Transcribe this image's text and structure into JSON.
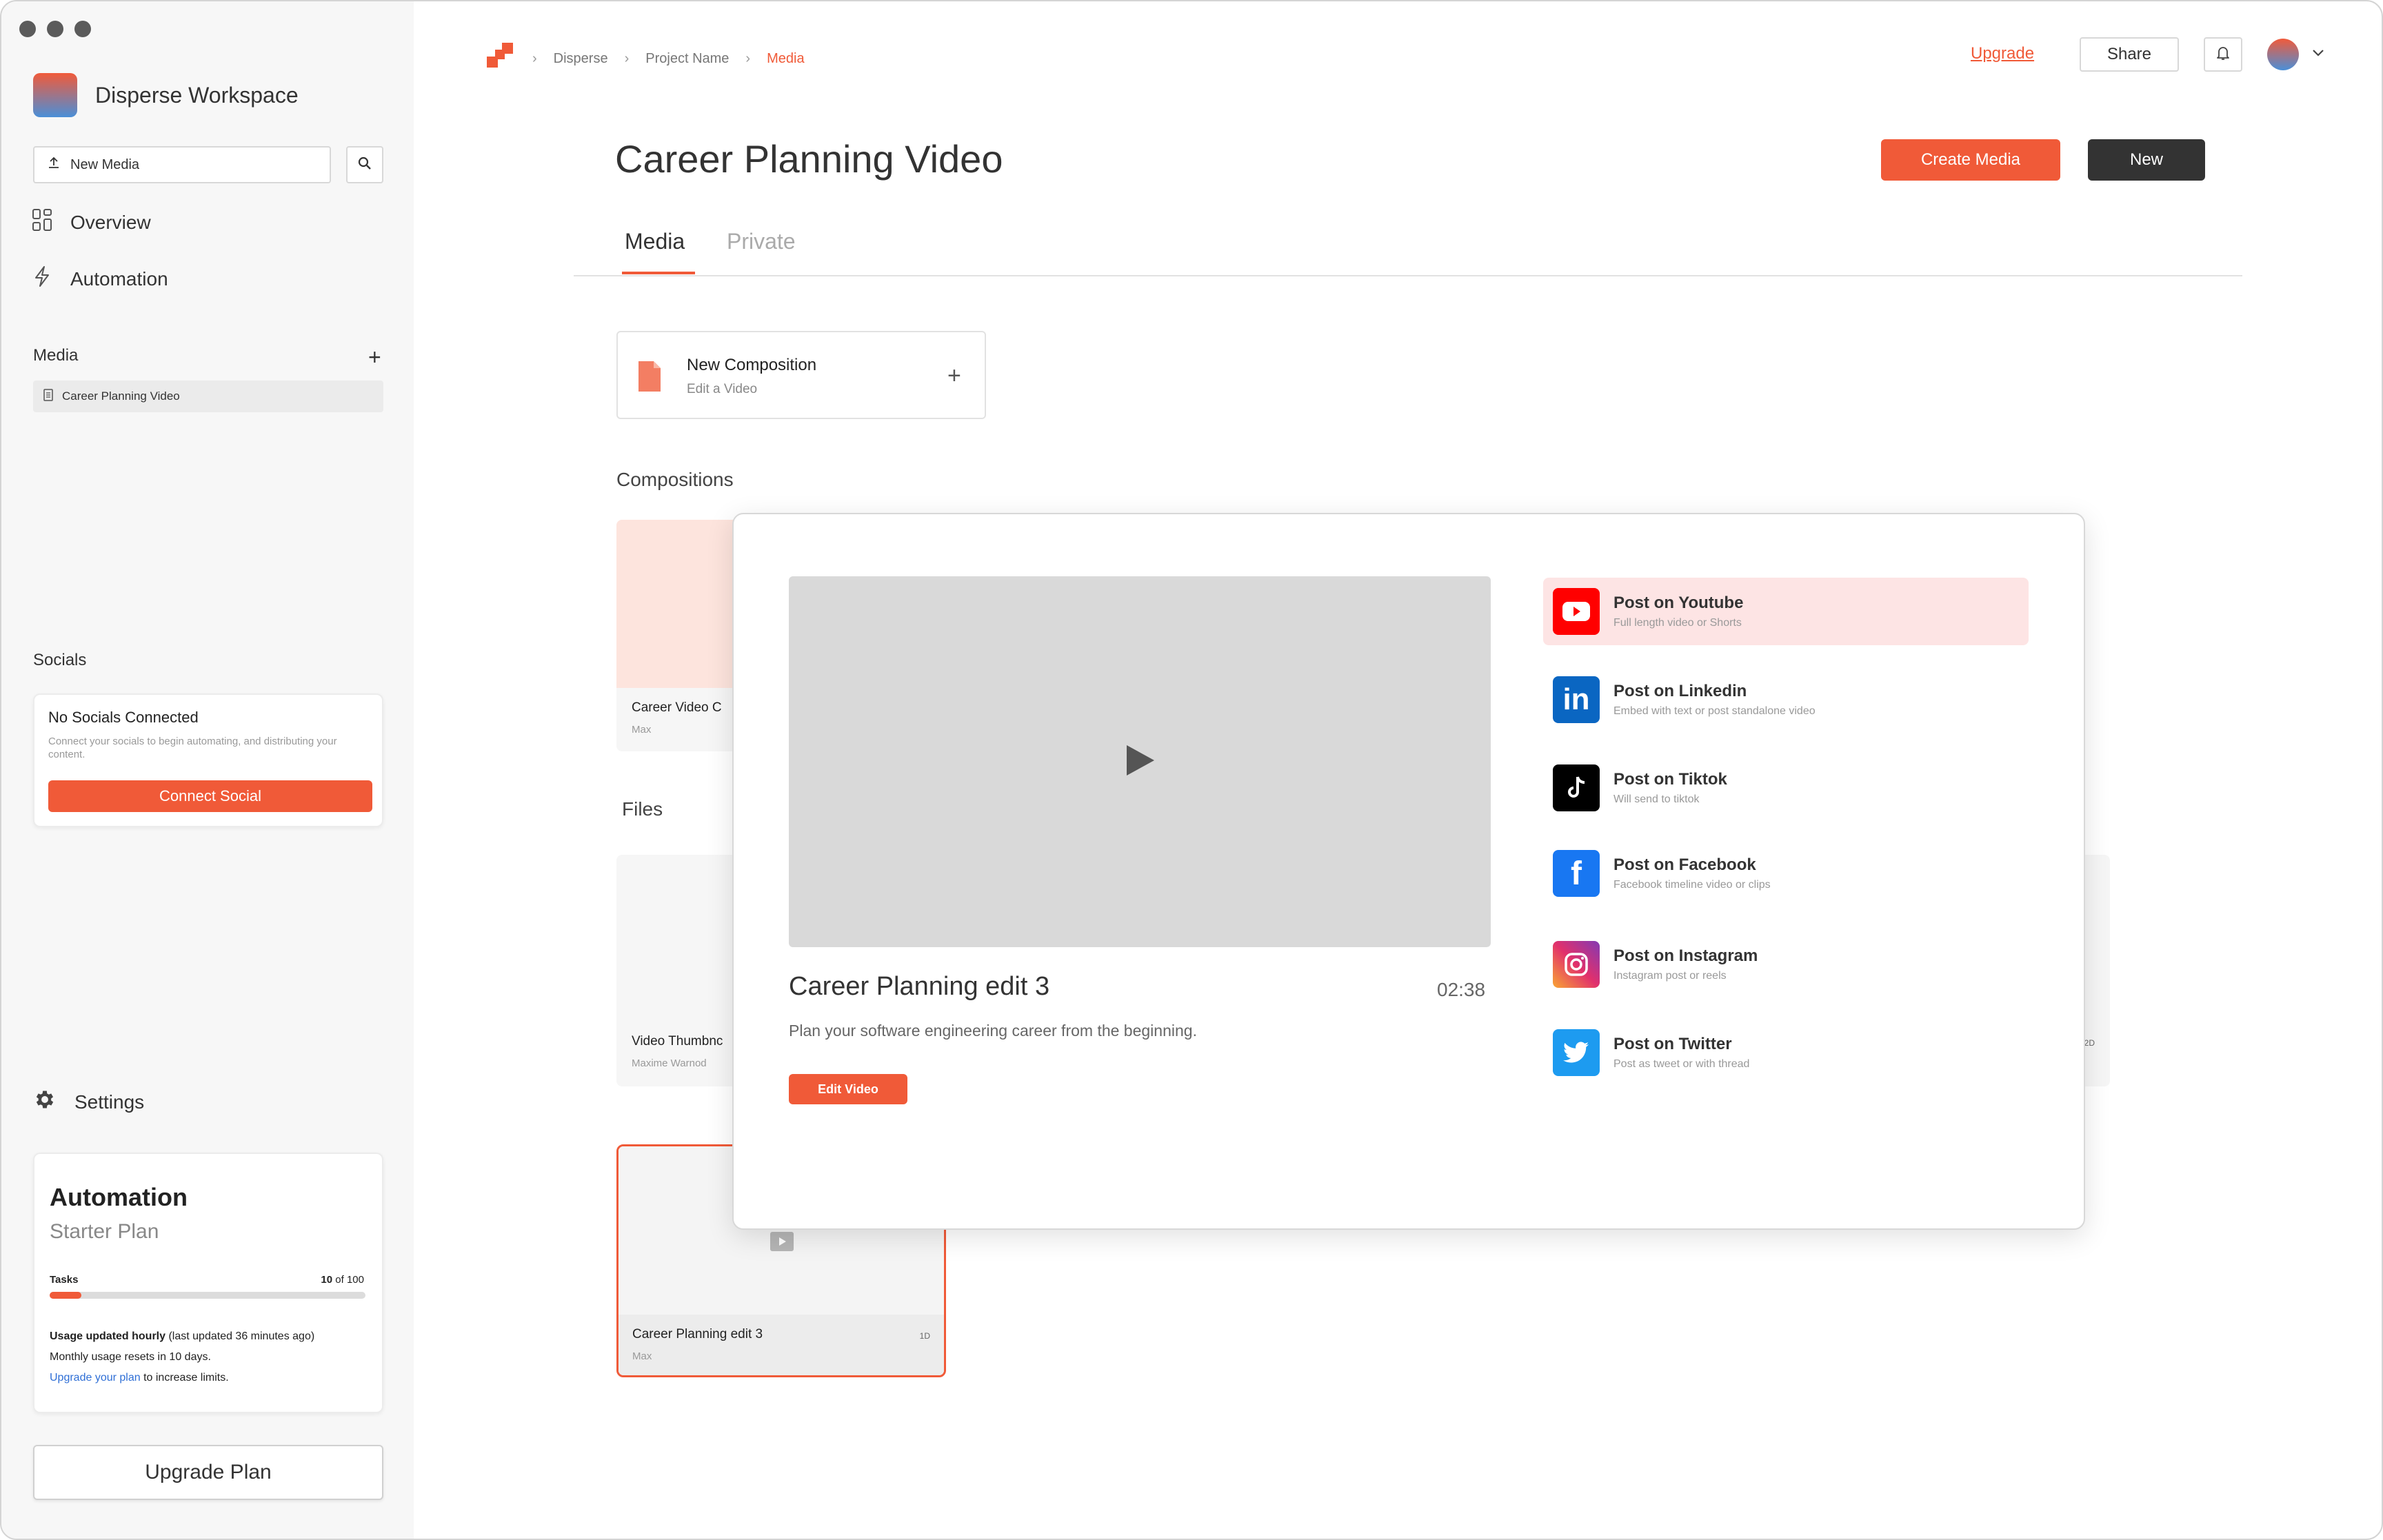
{
  "sidebar": {
    "workspace_name": "Disperse Workspace",
    "new_media_label": "New Media",
    "nav": {
      "overview": "Overview",
      "automation": "Automation"
    },
    "media_section": "Media",
    "media_items": [
      "Career Planning Video"
    ],
    "socials_section": "Socials",
    "socials_card": {
      "title": "No Socials Connected",
      "desc": "Connect your socials to begin automating, and distributing your content.",
      "button": "Connect Social"
    },
    "settings_label": "Settings",
    "plan_card": {
      "title": "Automation",
      "plan": "Starter Plan",
      "tasks_label": "Tasks",
      "tasks_used": "10",
      "tasks_total": "of 100",
      "tasks_fraction": 0.1,
      "usage_bold": "Usage updated hourly",
      "usage_rest": " (last updated 36 minutes ago)",
      "reset_text": "Monthly usage resets in 10 days.",
      "upgrade_link": "Upgrade your plan",
      "upgrade_rest": " to increase limits."
    },
    "upgrade_button": "Upgrade Plan"
  },
  "header": {
    "breadcrumbs": [
      "Disperse",
      "Project Name",
      "Media"
    ],
    "upgrade": "Upgrade",
    "share": "Share"
  },
  "page": {
    "title": "Career Planning Video",
    "create_media": "Create Media",
    "new": "New",
    "tabs": [
      "Media",
      "Private"
    ]
  },
  "new_composition": {
    "title": "New Composition",
    "subtitle": "Edit a Video"
  },
  "sections": {
    "compositions": "Compositions",
    "files": "Files"
  },
  "composition_card": {
    "title": "Career Video C",
    "author": "Max"
  },
  "file_card": {
    "title": "Video Thumbnc",
    "author": "Maxime Warnod",
    "right_meta": "2D"
  },
  "selected_card": {
    "title": "Career Planning edit 3",
    "author": "Max",
    "meta": "1D"
  },
  "modal": {
    "video_title": "Career Planning edit 3",
    "duration": "02:38",
    "description": "Plan your software engineering career from the beginning.",
    "edit_button": "Edit Video",
    "socials": [
      {
        "name": "Post on Youtube",
        "desc": "Full length video or Shorts",
        "icon": "youtube-icon",
        "color": "#ff0000"
      },
      {
        "name": "Post on Linkedin",
        "desc": "Embed with text or post standalone video",
        "icon": "linkedin-icon",
        "color": "#0a66c2"
      },
      {
        "name": "Post on Tiktok",
        "desc": "Will send to tiktok",
        "icon": "tiktok-icon",
        "color": "#000000"
      },
      {
        "name": "Post on Facebook",
        "desc": "Facebook timeline video or clips",
        "icon": "facebook-icon",
        "color": "#1877f2"
      },
      {
        "name": "Post on Instagram",
        "desc": "Instagram post or reels",
        "icon": "instagram-icon",
        "color": "#e1306c"
      },
      {
        "name": "Post on Twitter",
        "desc": "Post as tweet or with thread",
        "icon": "twitter-icon",
        "color": "#1d9bf0"
      }
    ]
  },
  "colors": {
    "accent": "#f05a38",
    "dark_button": "#333333",
    "youtube_highlight": "#fde4e4"
  }
}
